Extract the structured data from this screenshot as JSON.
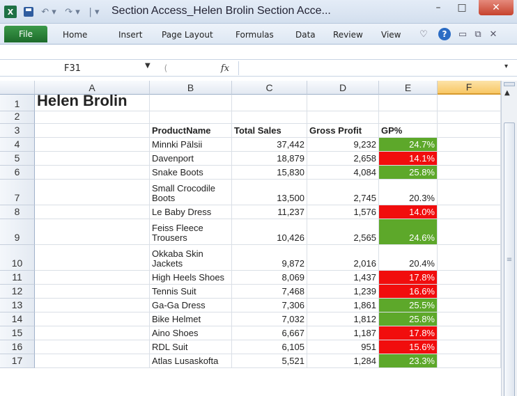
{
  "app": {
    "window_title": "Section Access_Helen Brolin Section Acce...",
    "excel_icon": "X",
    "accent": "#1e7145"
  },
  "window_controls": {
    "minimize": "–",
    "maximize": "□",
    "close": "✕"
  },
  "ribbon": {
    "file_label": "File",
    "tabs": [
      "Home",
      "Insert",
      "Page Layout",
      "Formulas",
      "Data",
      "Review",
      "View"
    ]
  },
  "formula_bar": {
    "name_box": "F31",
    "fx": "fx",
    "formula": ""
  },
  "columns": [
    "A",
    "B",
    "C",
    "D",
    "E",
    "F"
  ],
  "selected_column": "F",
  "sheet": {
    "title": "Helen Brolin",
    "headers": {
      "product": "ProductName",
      "sales": "Total Sales",
      "profit": "Gross Profit",
      "gp": "GP%"
    },
    "rows": [
      {
        "n": "1"
      },
      {
        "n": "2"
      },
      {
        "n": "3"
      },
      {
        "n": "4",
        "product": "Minnki Pälsii",
        "sales": "37,442",
        "profit": "9,232",
        "gp": "24.7%",
        "gp_color": "green"
      },
      {
        "n": "5",
        "product": "Davenport",
        "sales": "18,879",
        "profit": "2,658",
        "gp": "14.1%",
        "gp_color": "red"
      },
      {
        "n": "6",
        "product": "Snake Boots",
        "sales": "15,830",
        "profit": "4,084",
        "gp": "25.8%",
        "gp_color": "green"
      },
      {
        "n": "7",
        "product": "Small Crocodile Boots",
        "sales": "13,500",
        "profit": "2,745",
        "gp": "20.3%",
        "gp_color": "none"
      },
      {
        "n": "8",
        "product": "Le Baby Dress",
        "sales": "11,237",
        "profit": "1,576",
        "gp": "14.0%",
        "gp_color": "red"
      },
      {
        "n": "9",
        "product": "Feiss Fleece Trousers",
        "sales": "10,426",
        "profit": "2,565",
        "gp": "24.6%",
        "gp_color": "green"
      },
      {
        "n": "10",
        "product": "Okkaba Skin Jackets",
        "sales": "9,872",
        "profit": "2,016",
        "gp": "20.4%",
        "gp_color": "none"
      },
      {
        "n": "11",
        "product": "High Heels Shoes",
        "sales": "8,069",
        "profit": "1,437",
        "gp": "17.8%",
        "gp_color": "red"
      },
      {
        "n": "12",
        "product": "Tennis Suit",
        "sales": "7,468",
        "profit": "1,239",
        "gp": "16.6%",
        "gp_color": "red"
      },
      {
        "n": "13",
        "product": "Ga-Ga Dress",
        "sales": "7,306",
        "profit": "1,861",
        "gp": "25.5%",
        "gp_color": "green"
      },
      {
        "n": "14",
        "product": "Bike Helmet",
        "sales": "7,032",
        "profit": "1,812",
        "gp": "25.8%",
        "gp_color": "green"
      },
      {
        "n": "15",
        "product": "Aino Shoes",
        "sales": "6,667",
        "profit": "1,187",
        "gp": "17.8%",
        "gp_color": "red"
      },
      {
        "n": "16",
        "product": "RDL Suit",
        "sales": "6,105",
        "profit": "951",
        "gp": "15.6%",
        "gp_color": "red"
      },
      {
        "n": "17",
        "product": "Atlas Lusaskofta",
        "sales": "5,521",
        "profit": "1,284",
        "gp": "23.3%",
        "gp_color": "green"
      }
    ]
  },
  "colors": {
    "gp_green": "#5da82a",
    "gp_red": "#f10d0d"
  }
}
